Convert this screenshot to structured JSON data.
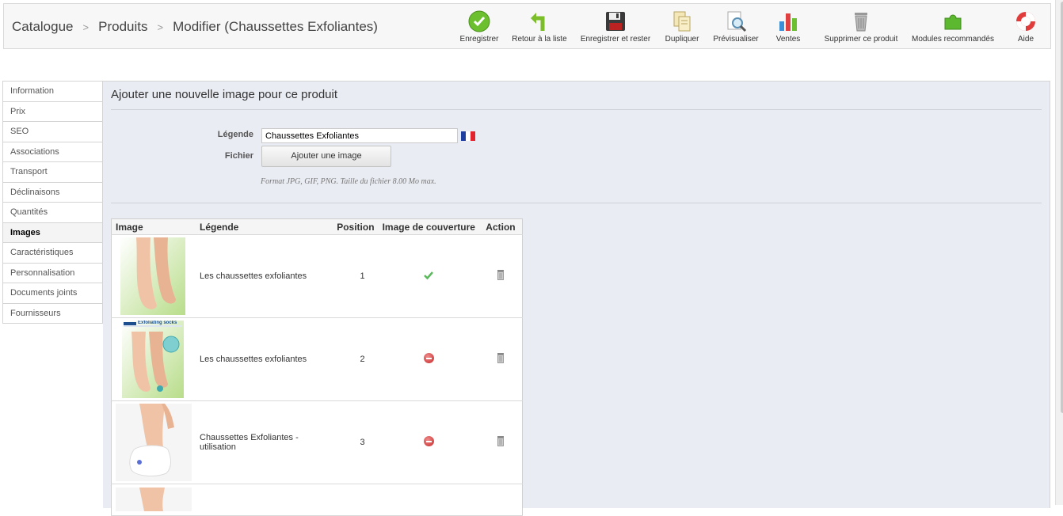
{
  "breadcrumb": [
    "Catalogue",
    "Produits",
    "Modifier (Chaussettes Exfoliantes)"
  ],
  "breadcrumb_sep": ">",
  "toolbar": [
    {
      "label": "Enregistrer",
      "icon": "save-check-icon"
    },
    {
      "label": "Retour à la liste",
      "icon": "back-arrow-icon"
    },
    {
      "label": "Enregistrer et rester",
      "icon": "floppy-disk-icon"
    },
    {
      "label": "Dupliquer",
      "icon": "duplicate-icon"
    },
    {
      "label": "Prévisualiser",
      "icon": "preview-icon"
    },
    {
      "label": "Ventes",
      "icon": "bar-chart-icon"
    },
    {
      "label": "Supprimer ce produit",
      "icon": "trash-icon"
    },
    {
      "label": "Modules recommandés",
      "icon": "puzzle-icon"
    },
    {
      "label": "Aide",
      "icon": "lifebuoy-icon"
    }
  ],
  "sidebar": [
    {
      "label": "Information"
    },
    {
      "label": "Prix"
    },
    {
      "label": "SEO"
    },
    {
      "label": "Associations"
    },
    {
      "label": "Transport"
    },
    {
      "label": "Déclinaisons"
    },
    {
      "label": "Quantités"
    },
    {
      "label": "Images",
      "active": true
    },
    {
      "label": "Caractéristiques"
    },
    {
      "label": "Personnalisation"
    },
    {
      "label": "Documents joints"
    },
    {
      "label": "Fournisseurs"
    }
  ],
  "main": {
    "title": "Ajouter une nouvelle image pour ce produit",
    "legend_label": "Légende",
    "legend_value": "Chaussettes Exfoliantes",
    "file_label": "Fichier",
    "add_image_button": "Ajouter une image",
    "hint": "Format JPG, GIF, PNG. Taille du fichier 8.00 Mo max."
  },
  "table": {
    "headers": [
      "Image",
      "Légende",
      "Position",
      "Image de couverture",
      "Action"
    ],
    "rows": [
      {
        "legend": "Les chaussettes exfoliantes",
        "position": "1",
        "cover": true,
        "thumb_text": ""
      },
      {
        "legend": "Les chaussettes exfoliantes",
        "position": "2",
        "cover": false,
        "thumb_text": "Exfoliating socks"
      },
      {
        "legend": "Chaussettes Exfoliantes - utilisation",
        "position": "3",
        "cover": false,
        "thumb_text": ""
      }
    ]
  },
  "colors": {
    "accent_green": "#5cb85c",
    "remove_red": "#d9534f",
    "panel_bg": "#eaecf3"
  }
}
